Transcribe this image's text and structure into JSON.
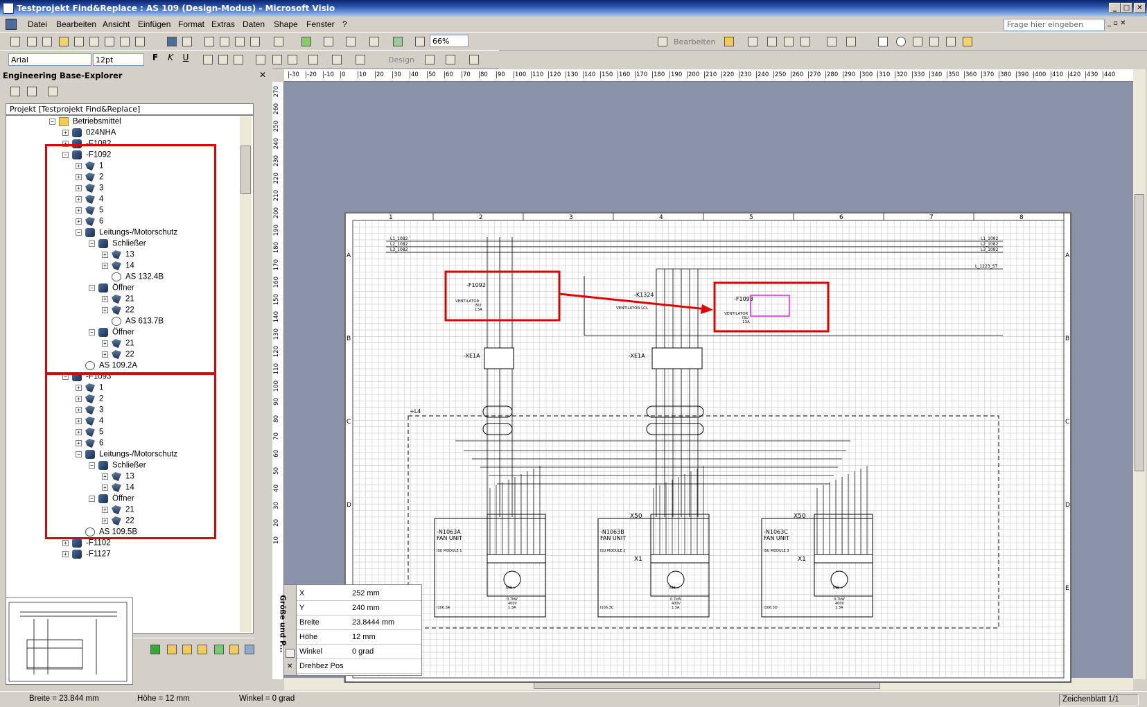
{
  "window": {
    "title": "Testprojekt Find&Replace : AS 109 (Design-Modus) - Microsoft Visio"
  },
  "menu": [
    "Datei",
    "Bearbeiten",
    "Ansicht",
    "Einfügen",
    "Format",
    "Extras",
    "Daten",
    "Shape",
    "Fenster",
    "?"
  ],
  "ask_placeholder": "Frage hier eingeben",
  "toolbar": {
    "zoom": "66%",
    "font": "Arial",
    "size": "12pt",
    "bearbeiten": "Bearbeiten",
    "design": "Design"
  },
  "explorer": {
    "title": "Engineering Base-Explorer",
    "path": "Projekt [Testprojekt Find&Replace]",
    "tree": [
      {
        "label": "Betriebsmittel",
        "level": 0,
        "pm": "-",
        "icon": "folder"
      },
      {
        "label": "024NHA",
        "level": 1,
        "pm": "+",
        "icon": "cube"
      },
      {
        "label": "-F1082",
        "level": 1,
        "pm": "+",
        "icon": "cube"
      },
      {
        "label": "-F1092",
        "level": 1,
        "pm": "-",
        "icon": "cube"
      },
      {
        "label": "1",
        "level": 2,
        "pm": "+",
        "icon": "part"
      },
      {
        "label": "2",
        "level": 2,
        "pm": "+",
        "icon": "part"
      },
      {
        "label": "3",
        "level": 2,
        "pm": "+",
        "icon": "part"
      },
      {
        "label": "4",
        "level": 2,
        "pm": "+",
        "icon": "part"
      },
      {
        "label": "5",
        "level": 2,
        "pm": "+",
        "icon": "part"
      },
      {
        "label": "6",
        "level": 2,
        "pm": "+",
        "icon": "part"
      },
      {
        "label": "Leitungs-/Motorschutz",
        "level": 2,
        "pm": "-",
        "icon": "cube"
      },
      {
        "label": "Schließer",
        "level": 3,
        "pm": "-",
        "icon": "cube"
      },
      {
        "label": "13",
        "level": 4,
        "pm": "+",
        "icon": "part"
      },
      {
        "label": "14",
        "level": 4,
        "pm": "+",
        "icon": "part"
      },
      {
        "label": "AS 132.4B",
        "level": 4,
        "pm": "",
        "icon": "doc"
      },
      {
        "label": "Öffner",
        "level": 3,
        "pm": "-",
        "icon": "cube"
      },
      {
        "label": "21",
        "level": 4,
        "pm": "+",
        "icon": "part"
      },
      {
        "label": "22",
        "level": 4,
        "pm": "+",
        "icon": "part"
      },
      {
        "label": "AS 613.7B",
        "level": 4,
        "pm": "",
        "icon": "doc"
      },
      {
        "label": "Öffner",
        "level": 3,
        "pm": "-",
        "icon": "cube"
      },
      {
        "label": "21",
        "level": 4,
        "pm": "+",
        "icon": "part"
      },
      {
        "label": "22",
        "level": 4,
        "pm": "+",
        "icon": "part"
      },
      {
        "label": "AS 109.2A",
        "level": 2,
        "pm": "",
        "icon": "doc"
      },
      {
        "label": "-F1093",
        "level": 1,
        "pm": "-",
        "icon": "cube"
      },
      {
        "label": "1",
        "level": 2,
        "pm": "+",
        "icon": "part"
      },
      {
        "label": "2",
        "level": 2,
        "pm": "+",
        "icon": "part"
      },
      {
        "label": "3",
        "level": 2,
        "pm": "+",
        "icon": "part"
      },
      {
        "label": "4",
        "level": 2,
        "pm": "+",
        "icon": "part"
      },
      {
        "label": "5",
        "level": 2,
        "pm": "+",
        "icon": "part"
      },
      {
        "label": "6",
        "level": 2,
        "pm": "+",
        "icon": "part"
      },
      {
        "label": "Leitungs-/Motorschutz",
        "level": 2,
        "pm": "-",
        "icon": "cube"
      },
      {
        "label": "Schließer",
        "level": 3,
        "pm": "-",
        "icon": "cube"
      },
      {
        "label": "13",
        "level": 4,
        "pm": "+",
        "icon": "part"
      },
      {
        "label": "14",
        "level": 4,
        "pm": "+",
        "icon": "part"
      },
      {
        "label": "Öffner",
        "level": 3,
        "pm": "-",
        "icon": "cube"
      },
      {
        "label": "21",
        "level": 4,
        "pm": "+",
        "icon": "part"
      },
      {
        "label": "22",
        "level": 4,
        "pm": "+",
        "icon": "part"
      },
      {
        "label": "AS 109.5B",
        "level": 2,
        "pm": "",
        "icon": "doc"
      },
      {
        "label": "-F1102",
        "level": 1,
        "pm": "+",
        "icon": "cube"
      },
      {
        "label": "-F1127",
        "level": 1,
        "pm": "+",
        "icon": "cube"
      }
    ]
  },
  "properties": {
    "panel_title": "Größe und P...",
    "rows": [
      {
        "k": "X",
        "v": "252 mm"
      },
      {
        "k": "Y",
        "v": "240 mm"
      },
      {
        "k": "Breite",
        "v": "23.8444 mm"
      },
      {
        "k": "Höhe",
        "v": "12 mm"
      },
      {
        "k": "Winkel",
        "v": "0 grad"
      },
      {
        "k": "Drehbez Pos",
        "v": ""
      }
    ]
  },
  "ruler": {
    "h": [
      "-30",
      "-20",
      "-10",
      "0",
      "10",
      "20",
      "30",
      "40",
      "50",
      "60",
      "70",
      "80",
      "90",
      "100",
      "110",
      "120",
      "130",
      "140",
      "150",
      "160",
      "170",
      "180",
      "190",
      "200",
      "210",
      "220",
      "230",
      "240",
      "250",
      "260",
      "270",
      "280",
      "290",
      "300",
      "310",
      "320",
      "330",
      "340",
      "350",
      "360",
      "370",
      "380",
      "390",
      "400",
      "410",
      "420",
      "430",
      "440"
    ],
    "v": [
      "270",
      "260",
      "250",
      "240",
      "230",
      "220",
      "210",
      "200",
      "190",
      "180",
      "170",
      "160",
      "150",
      "140",
      "130",
      "120",
      "110",
      "100",
      "90",
      "80",
      "70",
      "60",
      "50",
      "40",
      "30",
      "20",
      "10"
    ]
  },
  "drawing": {
    "cols": [
      "1",
      "2",
      "3",
      "4",
      "5",
      "6",
      "7",
      "8"
    ],
    "rows": [
      "A",
      "B",
      "C",
      "D",
      "E"
    ],
    "f1092": "-F1092",
    "f1093": "-F1093",
    "k1324": "-K1324",
    "ventilator": "VENTILATOR",
    "ventilator_lcl": "VENTILATOR LCL",
    "isu": "ISU",
    "amp": "13A",
    "xe1a": "-XE1A",
    "l4": "+L4",
    "lines": [
      "L1_1082",
      "L2_1082",
      "L3_1082"
    ],
    "lines_r": [
      "L1_1082",
      "L2_1082",
      "L3_1082",
      "L_1223_ST"
    ],
    "fans": [
      {
        "tag": "-N1063A",
        "name": "FAN UNIT",
        "mod": "ISU MODULE 1",
        "ref": "I106.3A"
      },
      {
        "tag": "-N1063B",
        "name": "FAN UNIT",
        "mod": "ISU MODULE 2",
        "ref": "I106.3C"
      },
      {
        "tag": "-N1063C",
        "name": "FAN UNIT",
        "mod": "ISU MODULE 3",
        "ref": "I106.3D"
      }
    ],
    "x50": "X50",
    "x1": "X1",
    "motor": "M3~",
    "kw": "0.7kW",
    "volt": "400V",
    "amps": "1.3A"
  },
  "status": {
    "breite": "Breite = 23.844 mm",
    "hoehe": "Höhe = 12 mm",
    "winkel": "Winkel = 0 grad",
    "sheet": "Zeichenblatt 1/1"
  }
}
